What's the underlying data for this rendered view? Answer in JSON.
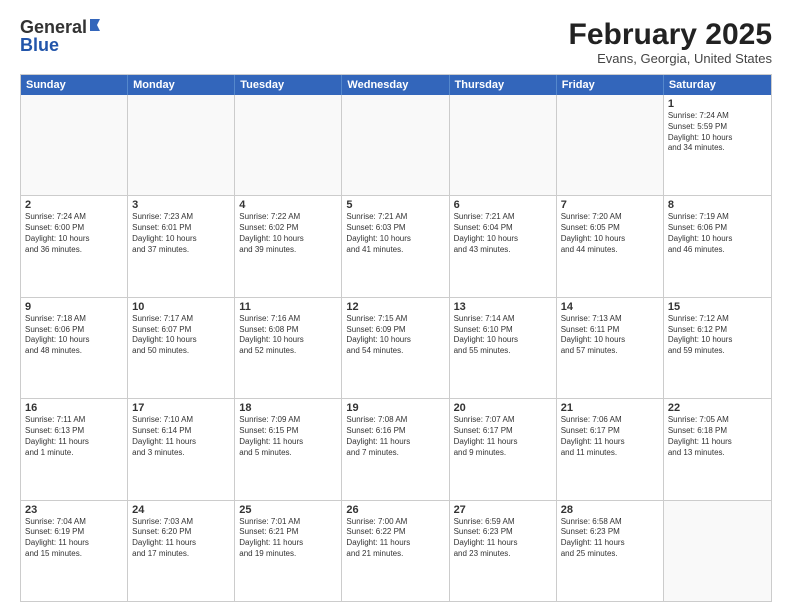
{
  "logo": {
    "general": "General",
    "blue": "Blue"
  },
  "title": "February 2025",
  "subtitle": "Evans, Georgia, United States",
  "header_days": [
    "Sunday",
    "Monday",
    "Tuesday",
    "Wednesday",
    "Thursday",
    "Friday",
    "Saturday"
  ],
  "rows": [
    [
      {
        "day": "",
        "text": ""
      },
      {
        "day": "",
        "text": ""
      },
      {
        "day": "",
        "text": ""
      },
      {
        "day": "",
        "text": ""
      },
      {
        "day": "",
        "text": ""
      },
      {
        "day": "",
        "text": ""
      },
      {
        "day": "1",
        "text": "Sunrise: 7:24 AM\nSunset: 5:59 PM\nDaylight: 10 hours\nand 34 minutes."
      }
    ],
    [
      {
        "day": "2",
        "text": "Sunrise: 7:24 AM\nSunset: 6:00 PM\nDaylight: 10 hours\nand 36 minutes."
      },
      {
        "day": "3",
        "text": "Sunrise: 7:23 AM\nSunset: 6:01 PM\nDaylight: 10 hours\nand 37 minutes."
      },
      {
        "day": "4",
        "text": "Sunrise: 7:22 AM\nSunset: 6:02 PM\nDaylight: 10 hours\nand 39 minutes."
      },
      {
        "day": "5",
        "text": "Sunrise: 7:21 AM\nSunset: 6:03 PM\nDaylight: 10 hours\nand 41 minutes."
      },
      {
        "day": "6",
        "text": "Sunrise: 7:21 AM\nSunset: 6:04 PM\nDaylight: 10 hours\nand 43 minutes."
      },
      {
        "day": "7",
        "text": "Sunrise: 7:20 AM\nSunset: 6:05 PM\nDaylight: 10 hours\nand 44 minutes."
      },
      {
        "day": "8",
        "text": "Sunrise: 7:19 AM\nSunset: 6:06 PM\nDaylight: 10 hours\nand 46 minutes."
      }
    ],
    [
      {
        "day": "9",
        "text": "Sunrise: 7:18 AM\nSunset: 6:06 PM\nDaylight: 10 hours\nand 48 minutes."
      },
      {
        "day": "10",
        "text": "Sunrise: 7:17 AM\nSunset: 6:07 PM\nDaylight: 10 hours\nand 50 minutes."
      },
      {
        "day": "11",
        "text": "Sunrise: 7:16 AM\nSunset: 6:08 PM\nDaylight: 10 hours\nand 52 minutes."
      },
      {
        "day": "12",
        "text": "Sunrise: 7:15 AM\nSunset: 6:09 PM\nDaylight: 10 hours\nand 54 minutes."
      },
      {
        "day": "13",
        "text": "Sunrise: 7:14 AM\nSunset: 6:10 PM\nDaylight: 10 hours\nand 55 minutes."
      },
      {
        "day": "14",
        "text": "Sunrise: 7:13 AM\nSunset: 6:11 PM\nDaylight: 10 hours\nand 57 minutes."
      },
      {
        "day": "15",
        "text": "Sunrise: 7:12 AM\nSunset: 6:12 PM\nDaylight: 10 hours\nand 59 minutes."
      }
    ],
    [
      {
        "day": "16",
        "text": "Sunrise: 7:11 AM\nSunset: 6:13 PM\nDaylight: 11 hours\nand 1 minute."
      },
      {
        "day": "17",
        "text": "Sunrise: 7:10 AM\nSunset: 6:14 PM\nDaylight: 11 hours\nand 3 minutes."
      },
      {
        "day": "18",
        "text": "Sunrise: 7:09 AM\nSunset: 6:15 PM\nDaylight: 11 hours\nand 5 minutes."
      },
      {
        "day": "19",
        "text": "Sunrise: 7:08 AM\nSunset: 6:16 PM\nDaylight: 11 hours\nand 7 minutes."
      },
      {
        "day": "20",
        "text": "Sunrise: 7:07 AM\nSunset: 6:17 PM\nDaylight: 11 hours\nand 9 minutes."
      },
      {
        "day": "21",
        "text": "Sunrise: 7:06 AM\nSunset: 6:17 PM\nDaylight: 11 hours\nand 11 minutes."
      },
      {
        "day": "22",
        "text": "Sunrise: 7:05 AM\nSunset: 6:18 PM\nDaylight: 11 hours\nand 13 minutes."
      }
    ],
    [
      {
        "day": "23",
        "text": "Sunrise: 7:04 AM\nSunset: 6:19 PM\nDaylight: 11 hours\nand 15 minutes."
      },
      {
        "day": "24",
        "text": "Sunrise: 7:03 AM\nSunset: 6:20 PM\nDaylight: 11 hours\nand 17 minutes."
      },
      {
        "day": "25",
        "text": "Sunrise: 7:01 AM\nSunset: 6:21 PM\nDaylight: 11 hours\nand 19 minutes."
      },
      {
        "day": "26",
        "text": "Sunrise: 7:00 AM\nSunset: 6:22 PM\nDaylight: 11 hours\nand 21 minutes."
      },
      {
        "day": "27",
        "text": "Sunrise: 6:59 AM\nSunset: 6:23 PM\nDaylight: 11 hours\nand 23 minutes."
      },
      {
        "day": "28",
        "text": "Sunrise: 6:58 AM\nSunset: 6:23 PM\nDaylight: 11 hours\nand 25 minutes."
      },
      {
        "day": "",
        "text": ""
      }
    ]
  ]
}
